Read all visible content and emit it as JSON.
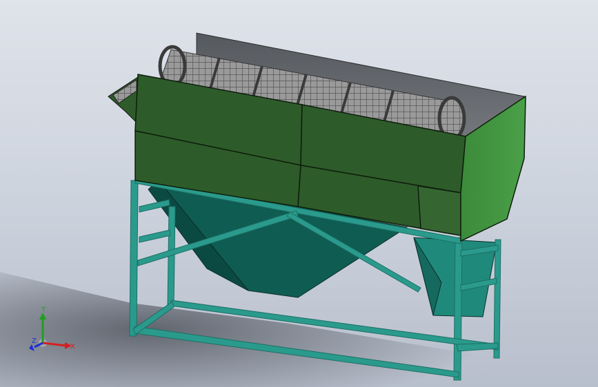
{
  "scene": {
    "subject": "rotary-drum-trommel-screen",
    "colors": {
      "background_top": "#dfe3ea",
      "background_bottom": "#b8bfcc",
      "frame_teal": "#2a9a8c",
      "hopper_teal": "#0f5c52",
      "panel_green": "#2e5b2a",
      "panel_green_light": "#3f8f3e",
      "drum_mesh": "#8a8a8a",
      "cover_gray": "#6b6e73"
    }
  },
  "triad": {
    "x_label": "X",
    "y_label": "Y",
    "z_label": "Z",
    "x_color": "#d62020",
    "y_color": "#1ea01e",
    "z_color": "#1d2fd0"
  }
}
